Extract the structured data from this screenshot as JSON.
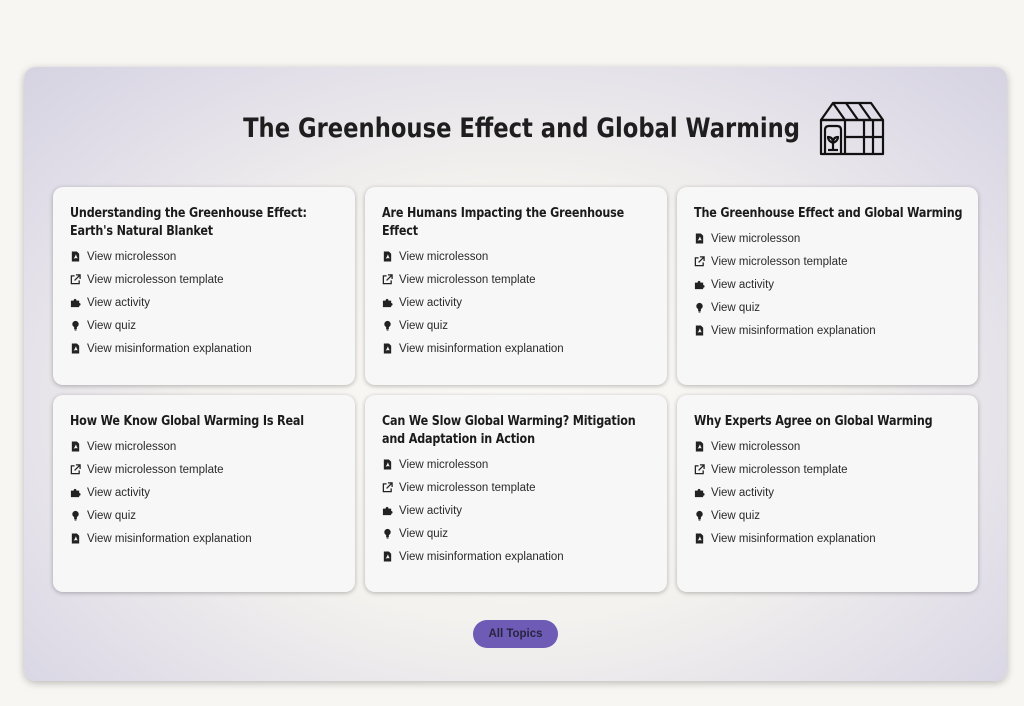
{
  "page": {
    "title": "The Greenhouse Effect and Global Warming"
  },
  "link_labels": {
    "microlesson": "View microlesson",
    "template": "View microlesson template",
    "activity": "View activity",
    "quiz": "View quiz",
    "misinfo": "View misinformation explanation"
  },
  "icons": {
    "microlesson": "pdf-file-icon",
    "template": "external-link-icon",
    "activity": "puzzle-icon",
    "quiz": "lightbulb-icon",
    "misinfo": "pdf-file-icon",
    "header": "greenhouse-icon"
  },
  "cards": [
    {
      "title": "Understanding the Greenhouse Effect: Earth's Natural Blanket"
    },
    {
      "title": "Are Humans Impacting the Greenhouse Effect"
    },
    {
      "title": "The Greenhouse Effect and Global Warming"
    },
    {
      "title": "How We Know Global Warming Is Real"
    },
    {
      "title": "Can We Slow Global Warming? Mitigation and Adaptation in Action"
    },
    {
      "title": "Why Experts Agree on Global Warming"
    }
  ],
  "footer": {
    "all_topics_label": "All Topics"
  },
  "colors": {
    "accent": "#6d5bb5",
    "background": "#f8f6f2",
    "card": "#f7f7f7"
  }
}
